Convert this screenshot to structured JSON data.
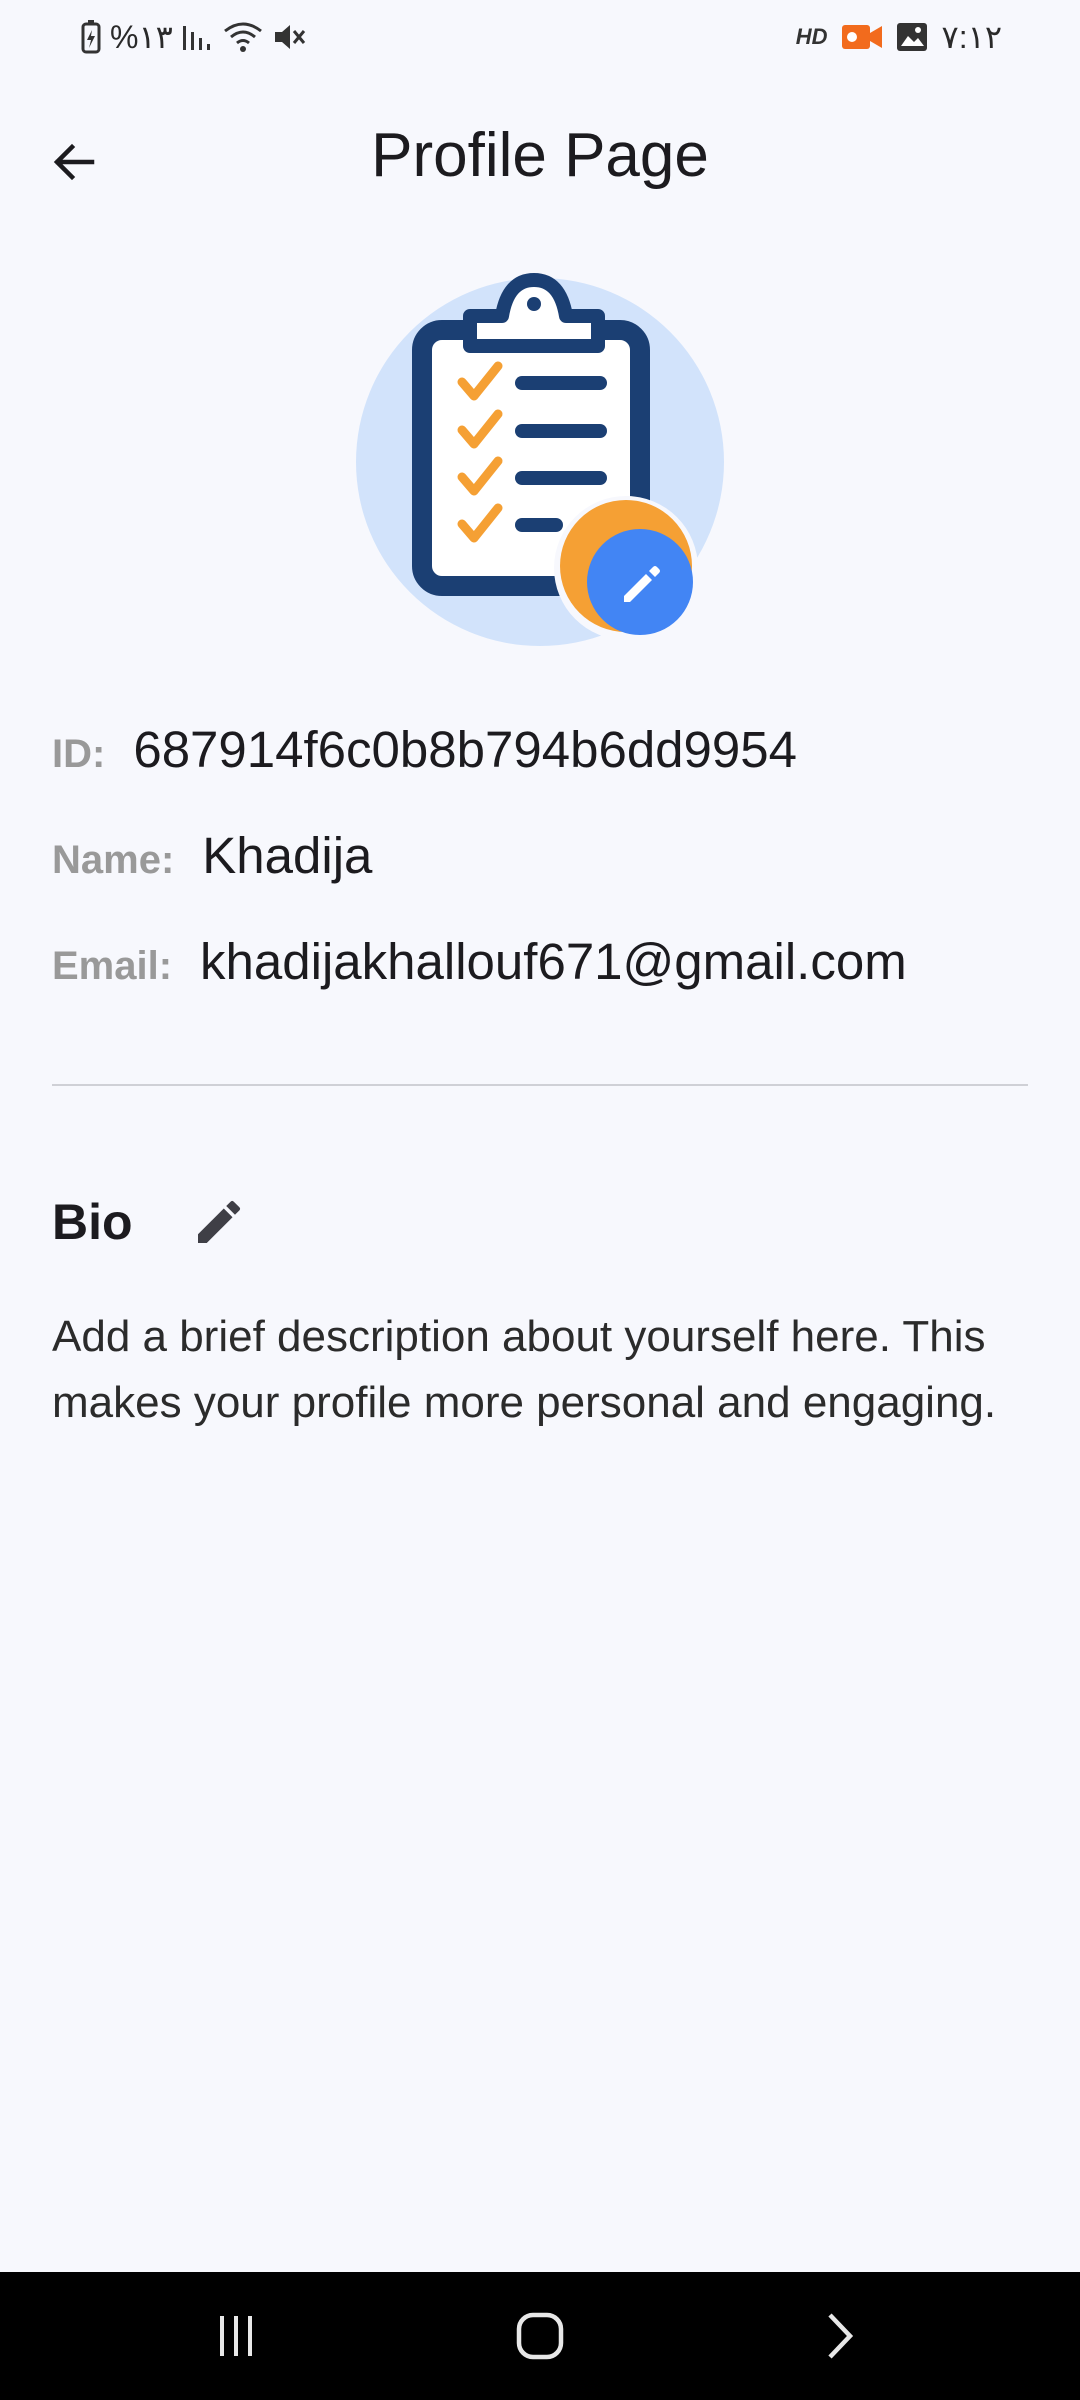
{
  "status_bar": {
    "battery": "%۱۳",
    "time": "۷:۱۲",
    "hd": "HD"
  },
  "app_bar": {
    "title": "Profile Page"
  },
  "profile": {
    "id_label": "ID:",
    "id_value": "687914f6c0b8b794b6dd9954",
    "name_label": "Name:",
    "name_value": "Khadija",
    "email_label": "Email:",
    "email_value": "khadijakhallouf671@gmail.com"
  },
  "bio": {
    "title": "Bio",
    "text": "Add a brief description about yourself here. This makes your profile more personal and engaging."
  },
  "icons": {
    "back": "arrow-left-icon",
    "edit": "pencil-icon",
    "avatar": "clipboard-checklist-icon"
  },
  "colors": {
    "background": "#f7f8fd",
    "avatar_circle": "#d2e3fb",
    "clipboard": "#1b3f73",
    "check": "#f5a034",
    "edit_badge": "#4285f4",
    "label": "#999999"
  }
}
